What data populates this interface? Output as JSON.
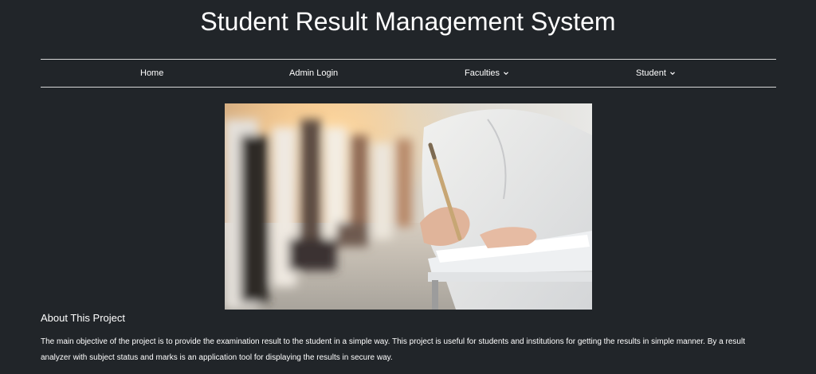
{
  "header": {
    "title": "Student Result Management System"
  },
  "nav": {
    "items": [
      {
        "label": "Home",
        "dropdown": false
      },
      {
        "label": "Admin Login",
        "dropdown": false
      },
      {
        "label": "Faculties",
        "dropdown": true
      },
      {
        "label": "Student",
        "dropdown": true
      }
    ]
  },
  "hero": {
    "image_icon": "student-writing-exam-photo"
  },
  "about": {
    "heading": "About This Project",
    "text": "The main objective of the project is to provide the examination result to the student in a simple way. This project is useful for students and institutions for getting the results in simple manner. By a result analyzer with subject status and marks is an application tool for displaying the results in secure way."
  },
  "colors": {
    "background": "#212529",
    "text": "#ffffff",
    "divider": "#d8d8d8"
  }
}
